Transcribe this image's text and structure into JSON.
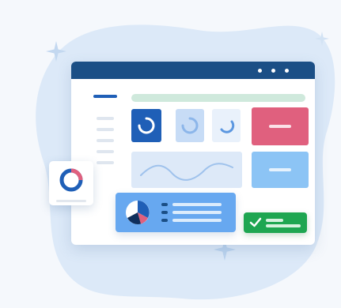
{
  "illustration": {
    "subject": "dashboard-window",
    "colors": {
      "background": "#f5f8fc",
      "blob": "#dce9f8",
      "titlebar": "#1b4f86",
      "accent_blue": "#1f5fb7",
      "pink": "#e0607e",
      "light_blue": "#8cc4f5",
      "green": "#1ea651"
    },
    "icons": [
      "sparkle-icon",
      "spinner-icon",
      "ring-logo-icon",
      "pie-chart-icon",
      "check-icon"
    ]
  }
}
